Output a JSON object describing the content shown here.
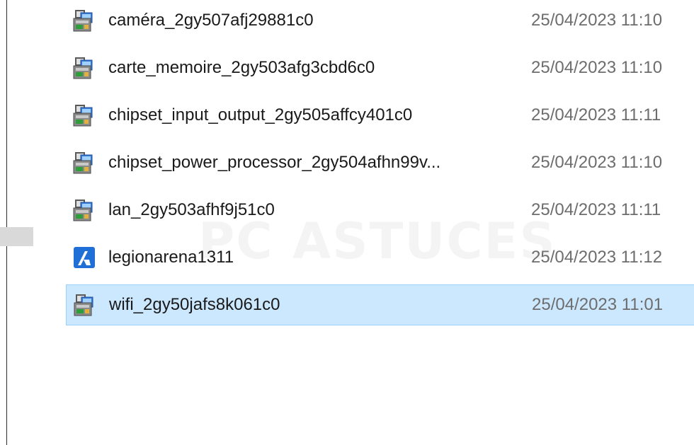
{
  "files": [
    {
      "name": "caméra_2gy507afj29881c0",
      "date": "25/04/2023 11:10",
      "icon": "installer-icon",
      "selected": false
    },
    {
      "name": "carte_memoire_2gy503afg3cbd6c0",
      "date": "25/04/2023 11:10",
      "icon": "installer-icon",
      "selected": false
    },
    {
      "name": "chipset_input_output_2gy505affcy401c0",
      "date": "25/04/2023 11:11",
      "icon": "installer-icon",
      "selected": false
    },
    {
      "name": "chipset_power_processor_2gy504afhn99v...",
      "date": "25/04/2023 11:10",
      "icon": "installer-icon",
      "selected": false
    },
    {
      "name": "lan_2gy503afhf9j51c0",
      "date": "25/04/2023 11:11",
      "icon": "installer-icon",
      "selected": false
    },
    {
      "name": "legionarena1311",
      "date": "25/04/2023 11:12",
      "icon": "app-shortcut-icon",
      "selected": false
    },
    {
      "name": "wifi_2gy50jafs8k061c0",
      "date": "25/04/2023 11:01",
      "icon": "installer-icon",
      "selected": true
    }
  ],
  "watermark": "PC ASTUCES",
  "colors": {
    "selection_bg": "#cce8ff",
    "selection_border": "#99d1ff",
    "date_text": "#6d6d6d"
  }
}
